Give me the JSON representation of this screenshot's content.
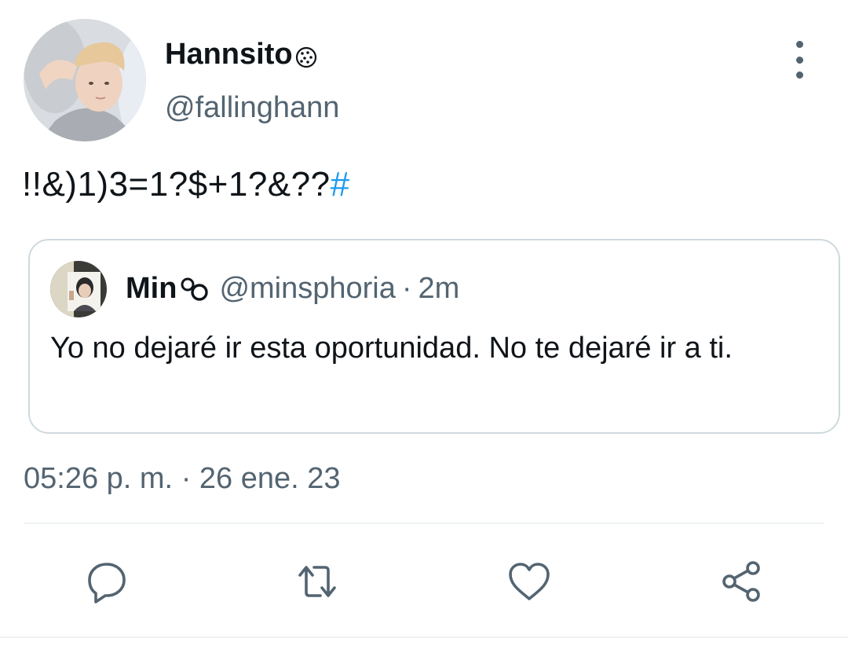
{
  "author": {
    "display_name": "Hannsito",
    "handle": "@fallinghann",
    "avatar_icon": "profile-photo",
    "name_emoji_icon": "cookie-icon"
  },
  "tweet": {
    "text": "!!&)1)3=1?$+1?&??",
    "hashtag": "#"
  },
  "quote": {
    "display_name": "Min",
    "name_emoji_icon": "infinity-icon",
    "handle": "@minsphoria",
    "separator": "·",
    "time": "2m",
    "text": "Yo no dejaré ir esta oportunidad. No te dejaré ir a ti."
  },
  "timestamp": {
    "time": "05:26 p. m.",
    "separator": "·",
    "date": "26 ene. 23"
  },
  "actions": [
    {
      "name": "reply",
      "icon": "reply-icon"
    },
    {
      "name": "retweet",
      "icon": "retweet-icon"
    },
    {
      "name": "like",
      "icon": "heart-icon"
    },
    {
      "name": "share",
      "icon": "share-icon"
    }
  ],
  "colors": {
    "text_primary": "#0f1419",
    "text_secondary": "#536471",
    "link": "#1d9bf0",
    "border": "#cfd9de",
    "divider": "#eff3f4"
  }
}
